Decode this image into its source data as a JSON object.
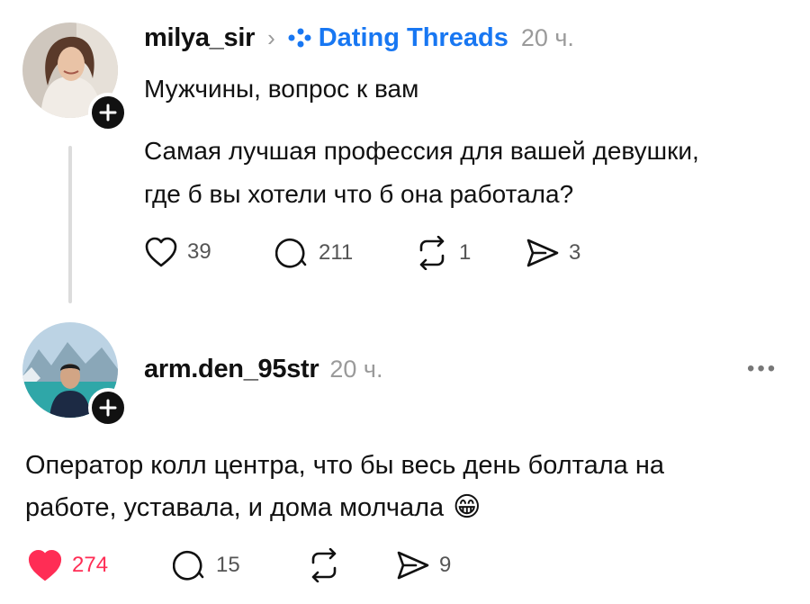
{
  "post1": {
    "username": "milya_sir",
    "separator": "›",
    "community": "Dating Threads",
    "time": "20 ч.",
    "title": "Мужчины, вопрос к вам",
    "body_line1": "Самая лучшая профессия для вашей девушки,",
    "body_line2": "где б вы хотели что б она работала?",
    "likes": "39",
    "comments": "211",
    "reposts": "1",
    "shares": "3"
  },
  "post2": {
    "username": "arm.den_95str",
    "time": "20 ч.",
    "more": "•••",
    "body_line1": "Оператор колл центра, что бы весь день болтала на",
    "body_line2": "работе, уставала, и дома молчала",
    "emoji": "😁",
    "likes": "274",
    "comments": "15",
    "shares": "9",
    "liked": true,
    "like_color": "#ff2d55"
  },
  "icons": [
    "plus-icon",
    "community-icon",
    "heart-icon",
    "comment-icon",
    "repost-icon",
    "share-icon",
    "more-icon"
  ]
}
